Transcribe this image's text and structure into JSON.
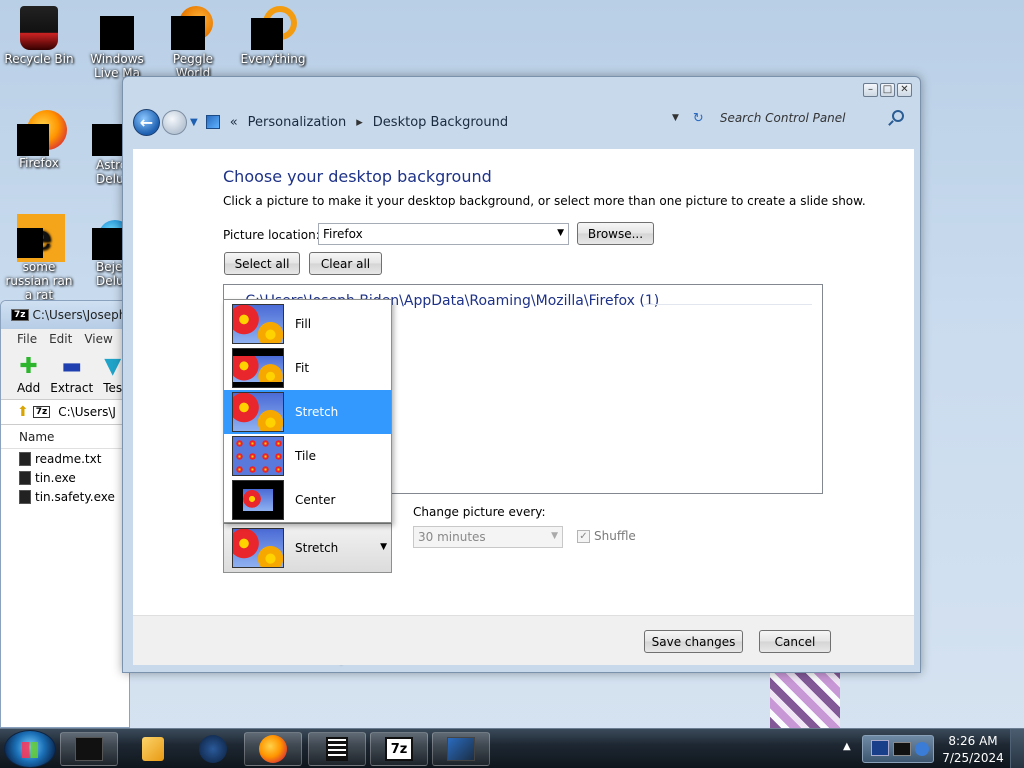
{
  "desktop": {
    "icons": [
      {
        "label": "Recycle Bin",
        "icon": "recycle-bin-icon"
      },
      {
        "label": "Windows Live Ma",
        "icon": "windows-live-icon"
      },
      {
        "label": "Peggle World",
        "icon": "peggle-icon"
      },
      {
        "label": "Everything",
        "icon": "everything-icon"
      },
      {
        "label": "Firefox",
        "icon": "firefox-icon"
      },
      {
        "label": "Astro Delu",
        "icon": "astro-icon"
      },
      {
        "label": "some russian ran a rat",
        "icon": "e-icon"
      },
      {
        "label": "Bejew Delu",
        "icon": "bejeweled-icon"
      }
    ]
  },
  "zip_window": {
    "title": "C:\\Users\\Joseph",
    "badge": "7z",
    "menu": [
      "File",
      "Edit",
      "View"
    ],
    "tools": [
      {
        "label": "Add",
        "icon": "add-icon"
      },
      {
        "label": "Extract",
        "icon": "extract-icon"
      },
      {
        "label": "Tes",
        "icon": "test-icon"
      }
    ],
    "path": "C:\\Users\\J",
    "column_name": "Name",
    "files": [
      "readme.txt",
      "tin.exe",
      "tin.safety.exe"
    ]
  },
  "control_panel": {
    "breadcrumb": {
      "overflow": "«",
      "items": [
        "Personalization",
        "Desktop Background"
      ],
      "separator": "▸"
    },
    "search_placeholder": "Search Control Panel",
    "title": "Choose your desktop background",
    "description": "Click a picture to make it your desktop background, or select more than one picture to create a slide show.",
    "picture_location_label": "Picture location:",
    "picture_location_value": "Firefox",
    "browse_label": "Browse...",
    "select_all_label": "Select all",
    "clear_all_label": "Clear all",
    "group_header": "C:\\Users\\Joseph Biden\\AppData\\Roaming\\Mozilla\\Firefox (1)",
    "picture_position": {
      "selected": "Stretch",
      "options": [
        {
          "label": "Fill",
          "selected": false
        },
        {
          "label": "Fit",
          "selected": false
        },
        {
          "label": "Stretch",
          "selected": true
        },
        {
          "label": "Tile",
          "selected": false
        },
        {
          "label": "Center",
          "selected": false
        }
      ]
    },
    "change_picture_label": "Change picture every:",
    "interval_value": "30 minutes",
    "shuffle_label": "Shuffle",
    "shuffle_checked": true,
    "save_label": "Save changes",
    "cancel_label": "Cancel"
  },
  "taskbar": {
    "time": "8:26 AM",
    "date": "7/25/2024",
    "colors": {
      "selection": "#3399ff",
      "title_blue": "#1e3287"
    }
  }
}
